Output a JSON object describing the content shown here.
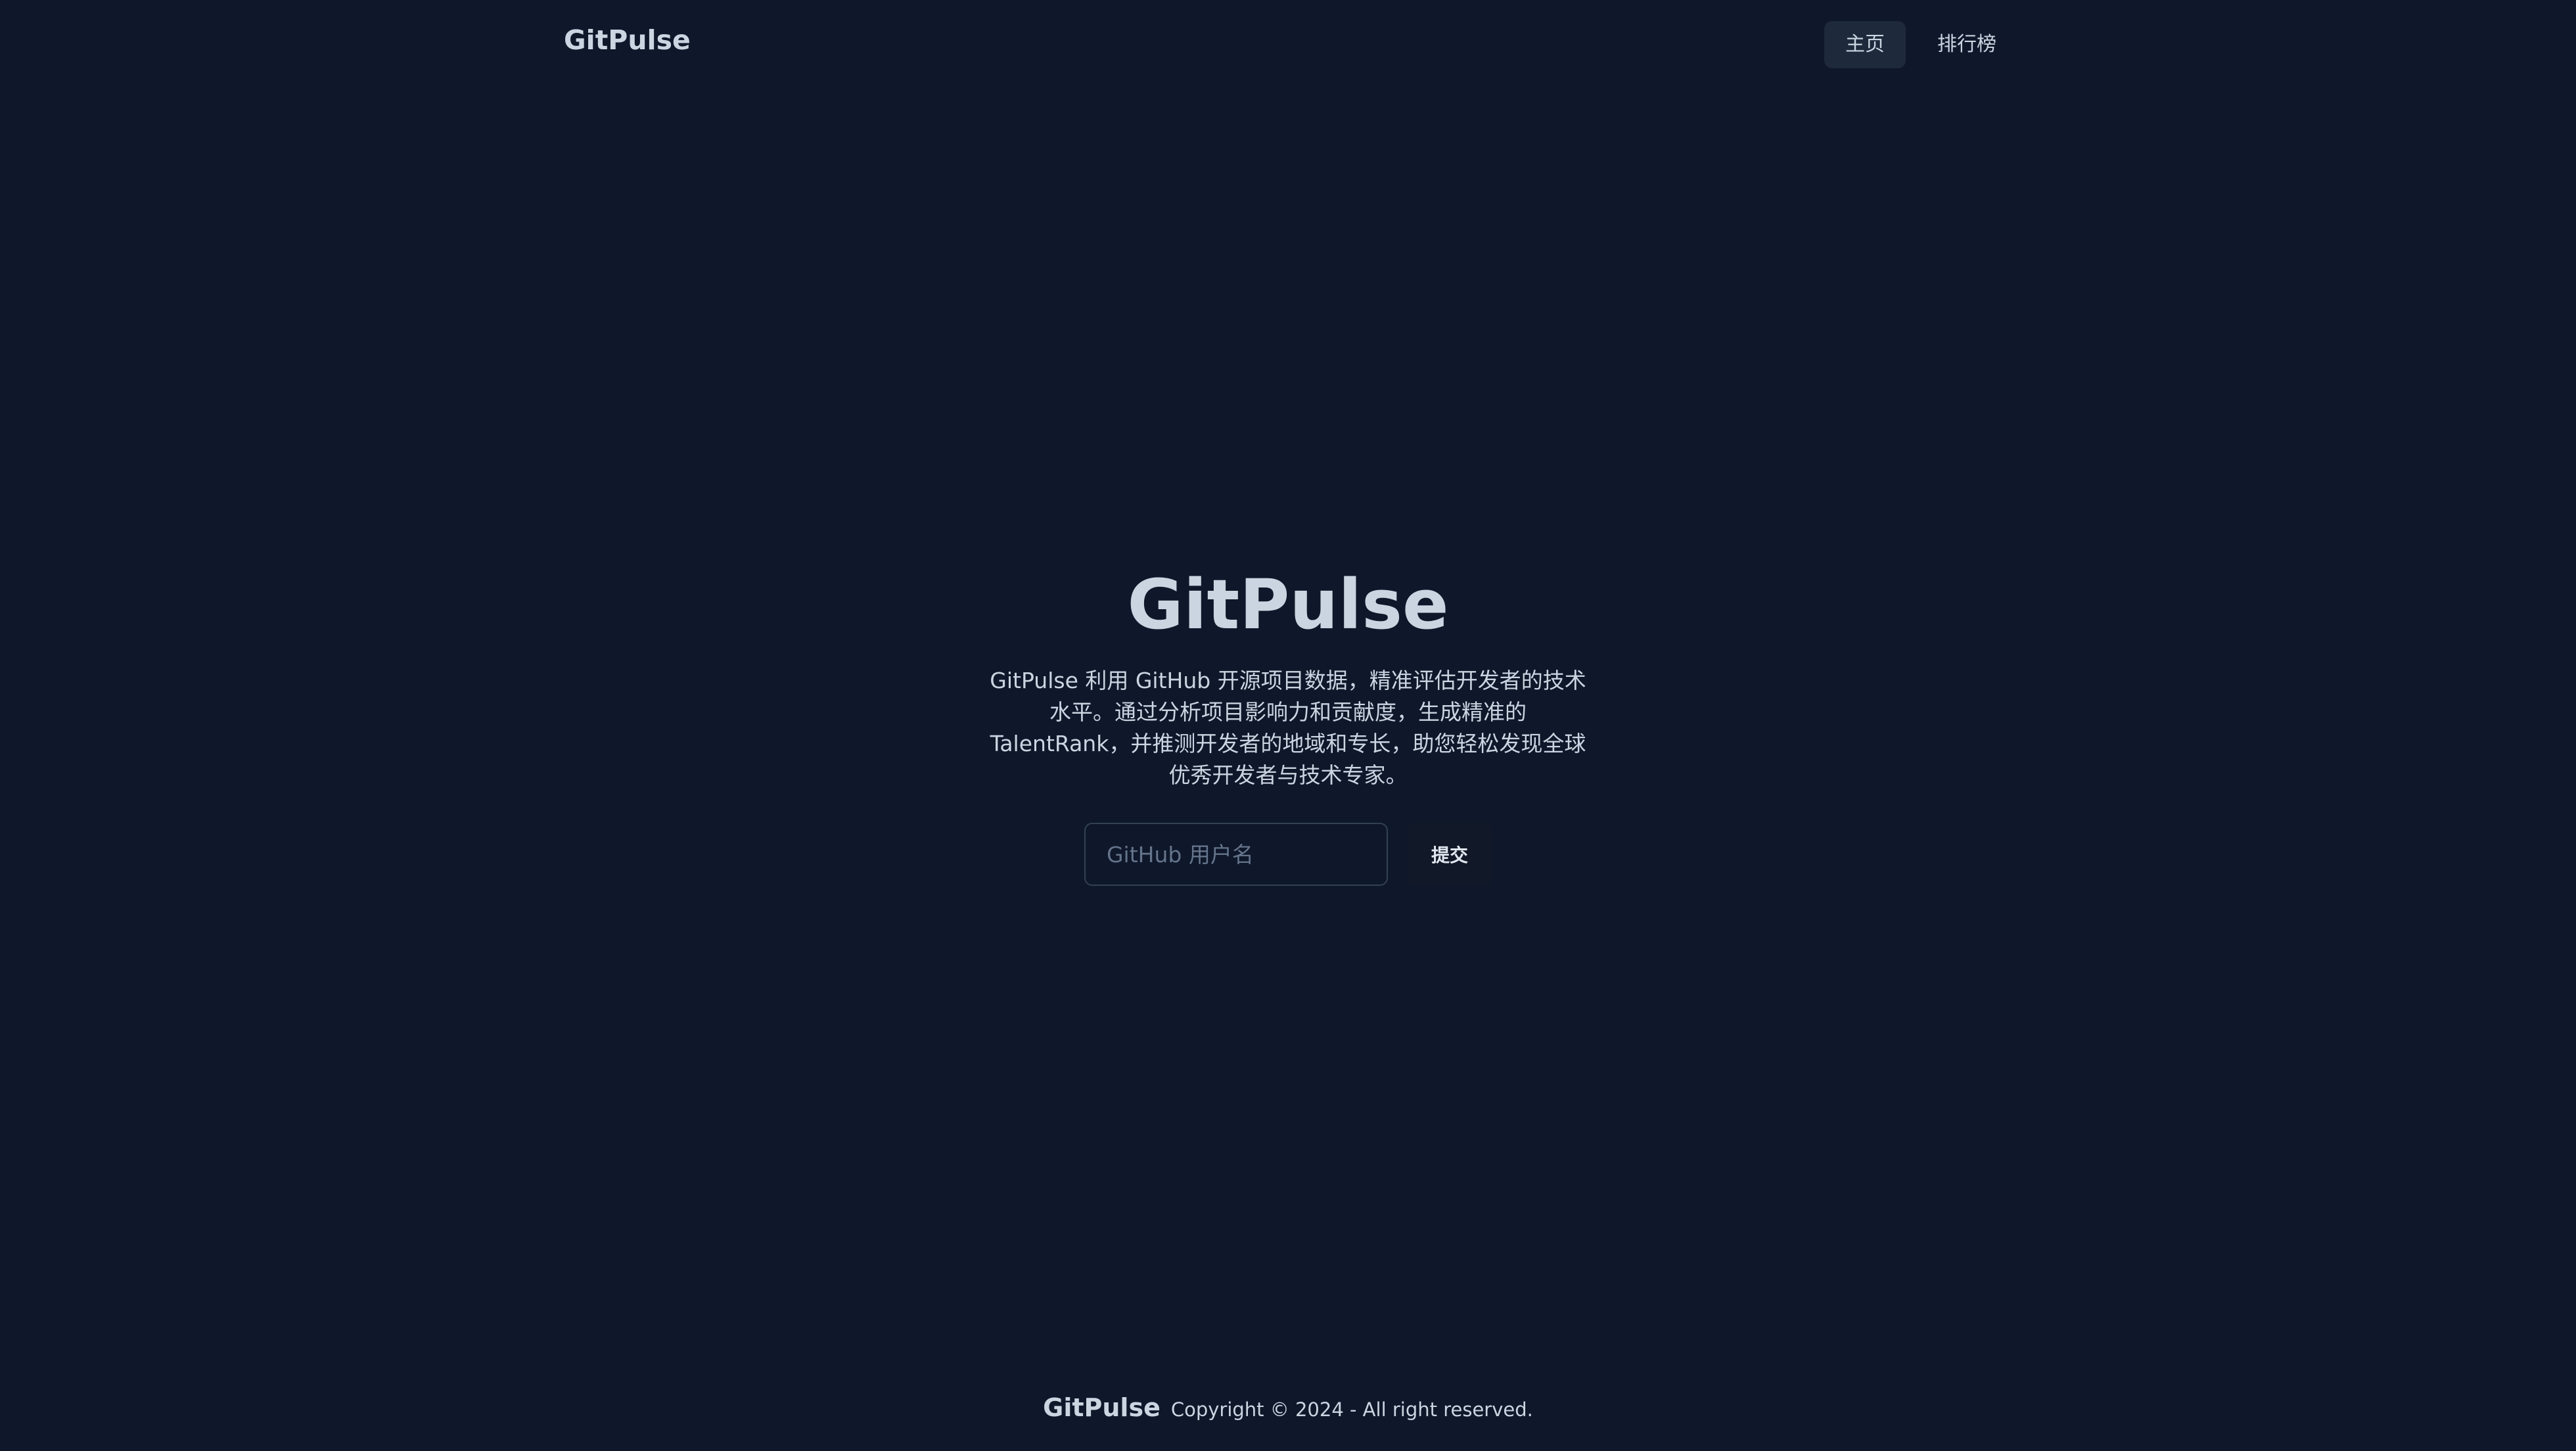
{
  "header": {
    "brand": "GitPulse",
    "nav": [
      {
        "label": "主页",
        "active": true
      },
      {
        "label": "排行榜",
        "active": false
      }
    ]
  },
  "hero": {
    "title": "GitPulse",
    "description": "GitPulse 利用 GitHub 开源项目数据，精准评估开发者的技术水平。通过分析项目影响力和贡献度，生成精准的 TalentRank，并推测开发者的地域和专长，助您轻松发现全球优秀开发者与技术专家。",
    "search": {
      "value": "",
      "placeholder": "GitHub 用户名"
    },
    "submit_label": "提交"
  },
  "footer": {
    "brand": "GitPulse",
    "copyright": "Copyright © 2024 - All right reserved."
  },
  "colors": {
    "background": "#0f172a",
    "text": "#cbd5e1",
    "nav_active_bg": "#1e293b",
    "button_bg": "#111827",
    "input_border": "#334155"
  }
}
